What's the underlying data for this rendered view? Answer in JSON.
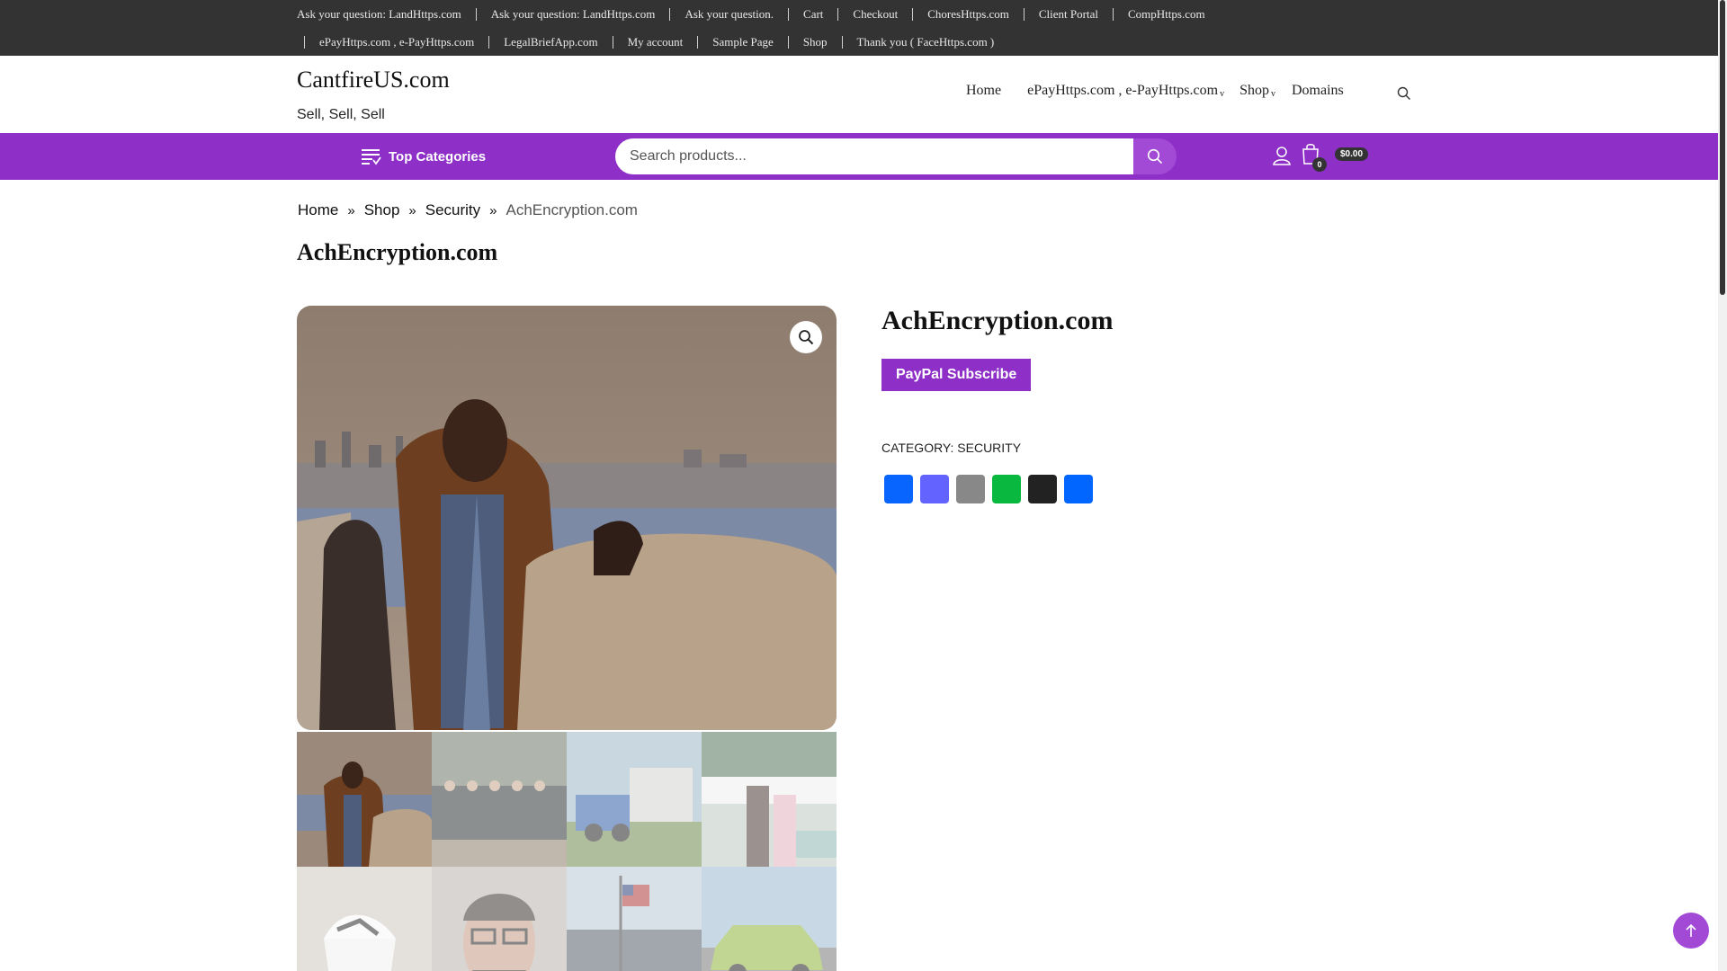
{
  "topbar": {
    "row1": [
      "Ask your question: LandHttps.com",
      "Ask your question: LandHttps.com",
      "Ask your question.",
      "Cart",
      "Checkout",
      "ChoresHttps.com",
      "Client Portal",
      "CompHttps.com"
    ],
    "row2": [
      "ePayHttps.com , e-PayHttps.com",
      "LegalBriefApp.com",
      "My account",
      "Sample Page",
      "Shop",
      "Thank you ( FaceHttps.com )"
    ]
  },
  "site": {
    "title": "CantfireUS.com",
    "tagline": "Sell, Sell, Sell"
  },
  "mainnav": {
    "home": "Home",
    "epay": "ePayHttps.com , e-PayHttps.com",
    "shop": "Shop",
    "domains": "Domains",
    "caret": "v"
  },
  "purplebar": {
    "top_categories": "Top Categories",
    "search_placeholder": "Search products...",
    "cart_count": "0",
    "cart_total": "$0.00"
  },
  "breadcrumb": {
    "home": "Home",
    "shop": "Shop",
    "security": "Security",
    "current": "AchEncryption.com",
    "separator": "»"
  },
  "page_title": "AchEncryption.com",
  "product": {
    "title": "AchEncryption.com",
    "button": "PayPal Subscribe",
    "category_label": "CATEGORY:",
    "category_value": "SECURITY",
    "share_icons": [
      "facebook-icon",
      "mastodon-icon",
      "email-icon",
      "wechat-icon",
      "x-icon",
      "share-icon"
    ]
  },
  "colors": {
    "topbar": "#333333",
    "purple": "#8e2fc7",
    "purple_light": "#a24ad6",
    "facebook": "#0866ff",
    "mastodon": "#6364ff",
    "email": "#888888",
    "wechat": "#09b83e",
    "x": "#222222",
    "share": "#0166ff"
  }
}
